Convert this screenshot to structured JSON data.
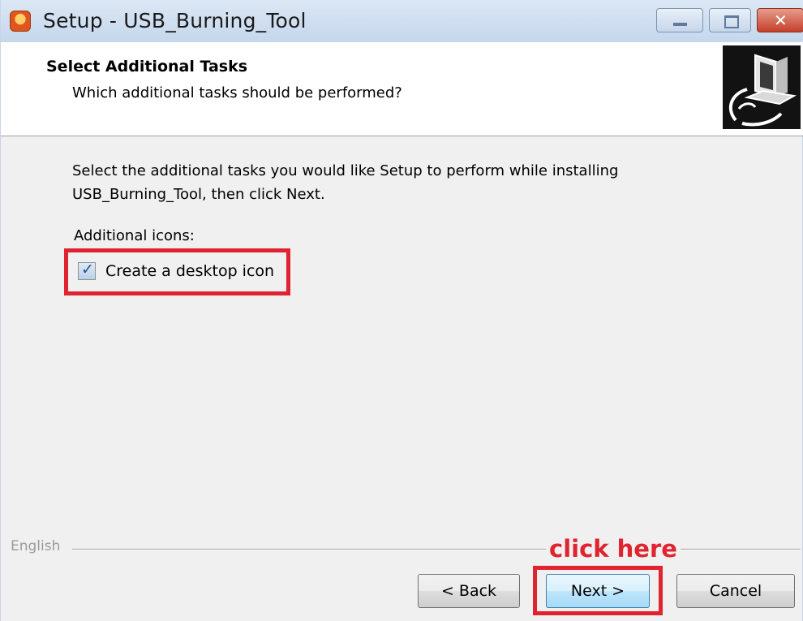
{
  "window": {
    "title": "Setup - USB_Burning_Tool"
  },
  "header": {
    "title": "Select Additional Tasks",
    "subtitle": "Which additional tasks should be performed?",
    "logo_icon": "computer-setup-icon"
  },
  "body": {
    "intro_line1": "Select the additional tasks you would like Setup to perform while installing",
    "intro_line2": "USB_Burning_Tool, then click Next.",
    "section_label": "Additional icons:",
    "tasks": [
      {
        "label": "Create a desktop icon",
        "checked": true
      }
    ]
  },
  "footer": {
    "language": "English",
    "annotation": "click here",
    "back_label": "< Back",
    "next_label": "Next >",
    "cancel_label": "Cancel"
  },
  "colors": {
    "highlight": "#e0232e",
    "titlebar": "#c5d7ec",
    "dialog_bg": "#f0f0f0"
  }
}
